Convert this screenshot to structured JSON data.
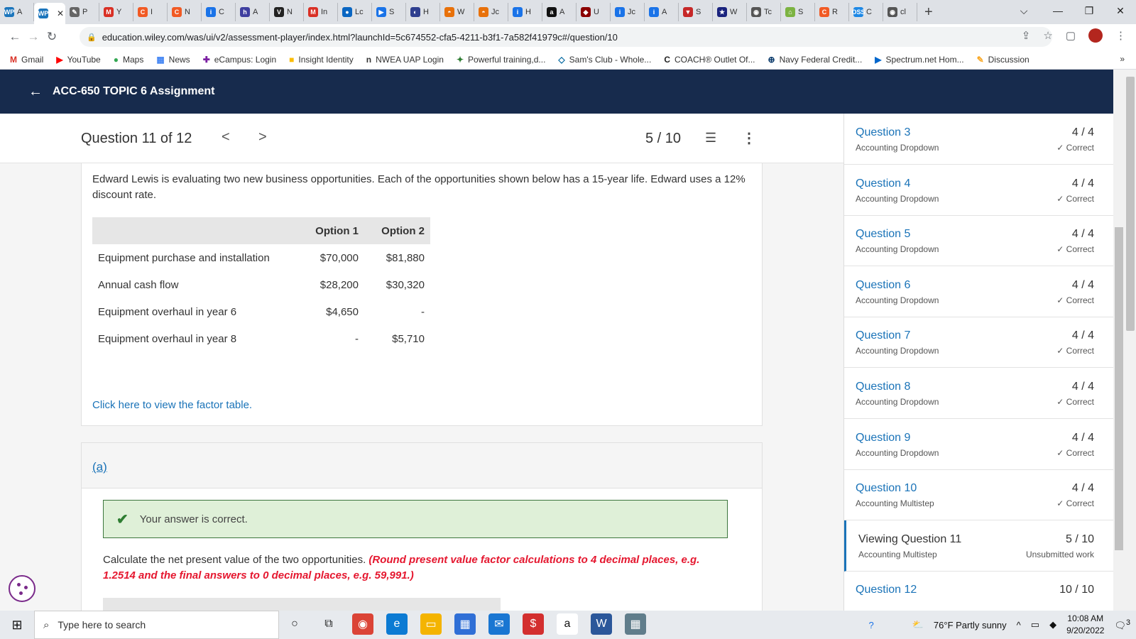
{
  "browser": {
    "tabs": [
      {
        "label": "A",
        "icon": "WP",
        "color": "#1b75bc"
      },
      {
        "label": "",
        "icon": "WP",
        "color": "#1b75bc",
        "active": true
      },
      {
        "label": "P",
        "icon": "✎",
        "color": "#666666"
      },
      {
        "label": "Y",
        "icon": "M",
        "color": "#d93025"
      },
      {
        "label": "I",
        "icon": "C",
        "color": "#f15a24"
      },
      {
        "label": "N",
        "icon": "C",
        "color": "#f15a24"
      },
      {
        "label": "C",
        "icon": "i",
        "color": "#1a73e8"
      },
      {
        "label": "A",
        "icon": "h",
        "color": "#3f3f9f"
      },
      {
        "label": "N",
        "icon": "V",
        "color": "#222222"
      },
      {
        "label": "In",
        "icon": "M",
        "color": "#d93025"
      },
      {
        "label": "Lc",
        "icon": "●",
        "color": "#0a66c2"
      },
      {
        "label": "S",
        "icon": "▶",
        "color": "#1a73e8"
      },
      {
        "label": "H",
        "icon": "◐",
        "color": "#2f3f8f"
      },
      {
        "label": "W",
        "icon": "◓",
        "color": "#e8710a"
      },
      {
        "label": "Jc",
        "icon": "◓",
        "color": "#e8710a"
      },
      {
        "label": "H",
        "icon": "i",
        "color": "#1a73e8"
      },
      {
        "label": "A",
        "icon": "a",
        "color": "#111111"
      },
      {
        "label": "U",
        "icon": "◆",
        "color": "#8b0000"
      },
      {
        "label": "Jc",
        "icon": "i",
        "color": "#1a73e8"
      },
      {
        "label": "A",
        "icon": "i",
        "color": "#1a73e8"
      },
      {
        "label": "S",
        "icon": "▼",
        "color": "#c62828"
      },
      {
        "label": "W",
        "icon": "★",
        "color": "#1a237e"
      },
      {
        "label": "Tc",
        "icon": "◉",
        "color": "#555555"
      },
      {
        "label": "S",
        "icon": "⌂",
        "color": "#7cb342"
      },
      {
        "label": "R",
        "icon": "C",
        "color": "#f15a24"
      },
      {
        "label": "C",
        "icon": "OSS",
        "color": "#1e88e5"
      },
      {
        "label": "cl",
        "icon": "◉",
        "color": "#555555"
      }
    ],
    "new_tab": "+",
    "window": {
      "chevron": "⌵",
      "minimize": "—",
      "restore": "❐",
      "close": "✕"
    },
    "url": "education.wiley.com/was/ui/v2/assessment-player/index.html?launchId=5c674552-cfa5-4211-b3f1-7a582f41979c#/question/10",
    "bookmarks": [
      {
        "label": "Gmail",
        "icon": "M",
        "color": "#d93025"
      },
      {
        "label": "YouTube",
        "icon": "▶",
        "color": "#ff0000"
      },
      {
        "label": "Maps",
        "icon": "●",
        "color": "#34a853"
      },
      {
        "label": "News",
        "icon": "▦",
        "color": "#4285f4"
      },
      {
        "label": "eCampus: Login",
        "icon": "✚",
        "color": "#7b1fa2"
      },
      {
        "label": "Insight Identity",
        "icon": "■",
        "color": "#fbbc05"
      },
      {
        "label": "NWEA UAP Login",
        "icon": "n",
        "color": "#333333"
      },
      {
        "label": "Powerful training,d...",
        "icon": "✦",
        "color": "#2e7d32"
      },
      {
        "label": "Sam's Club - Whole...",
        "icon": "◇",
        "color": "#0067a0"
      },
      {
        "label": "COACH® Outlet Of...",
        "icon": "C",
        "color": "#222222"
      },
      {
        "label": "Navy Federal Credit...",
        "icon": "⊕",
        "color": "#003366"
      },
      {
        "label": "Spectrum.net Hom...",
        "icon": "▶",
        "color": "#0066cc"
      },
      {
        "label": "Discussion",
        "icon": "✎",
        "color": "#f9a825"
      }
    ],
    "bookmarks_more": "»"
  },
  "header": {
    "title": "ACC-650 TOPIC 6 Assignment"
  },
  "question_bar": {
    "title": "Question 11 of 12",
    "prev": "<",
    "next": ">",
    "score": "5 / 10",
    "list_icon": "☰",
    "more_icon": "⋮"
  },
  "question": {
    "text": "Edward Lewis is evaluating two new business opportunities. Each of the opportunities shown below has a 15-year life. Edward uses a 12% discount rate.",
    "table": {
      "headers": [
        "",
        "Option 1",
        "Option 2"
      ],
      "rows": [
        [
          "Equipment purchase and installation",
          "$70,000",
          "$81,880"
        ],
        [
          "Annual cash flow",
          "$28,200",
          "$30,320"
        ],
        [
          "Equipment overhaul in year 6",
          "$4,650",
          "-"
        ],
        [
          "Equipment overhaul in year 8",
          "-",
          "$5,710"
        ]
      ]
    },
    "factor_link": "Click here to view the factor table."
  },
  "part_a": {
    "label": "(a)",
    "correct_msg": "Your answer is correct.",
    "instruction": "Calculate the net present value of the two opportunities.",
    "instruction_red": "(Round present value factor calculations to 4 decimal places, e.g. 1.2514 and the final answers to 0 decimal places, e.g. 59,991.)"
  },
  "sidebar": {
    "items": [
      {
        "title": "Question 3",
        "sub": "Accounting Dropdown",
        "score": "4 / 4",
        "status": "✓ Correct"
      },
      {
        "title": "Question 4",
        "sub": "Accounting Dropdown",
        "score": "4 / 4",
        "status": "✓ Correct"
      },
      {
        "title": "Question 5",
        "sub": "Accounting Dropdown",
        "score": "4 / 4",
        "status": "✓ Correct"
      },
      {
        "title": "Question 6",
        "sub": "Accounting Dropdown",
        "score": "4 / 4",
        "status": "✓ Correct"
      },
      {
        "title": "Question 7",
        "sub": "Accounting Dropdown",
        "score": "4 / 4",
        "status": "✓ Correct"
      },
      {
        "title": "Question 8",
        "sub": "Accounting Dropdown",
        "score": "4 / 4",
        "status": "✓ Correct"
      },
      {
        "title": "Question 9",
        "sub": "Accounting Dropdown",
        "score": "4 / 4",
        "status": "✓ Correct"
      },
      {
        "title": "Question 10",
        "sub": "Accounting Multistep",
        "score": "4 / 4",
        "status": "✓ Correct"
      },
      {
        "title": "Viewing Question 11",
        "sub": "Accounting Multistep",
        "score": "5 / 10",
        "status": "Unsubmitted work",
        "current": true
      },
      {
        "title": "Question 12",
        "sub": "",
        "score": "10 / 10",
        "status": ""
      }
    ]
  },
  "taskbar": {
    "search_placeholder": "Type here to search",
    "weather": "76°F  Partly sunny",
    "time": "10:08 AM",
    "date": "9/20/2022",
    "notifications": "3"
  },
  "colors": {
    "header_bg": "#172b4d",
    "link": "#1a73b8",
    "success_bg": "#dff0d8",
    "success_border": "#3c763d",
    "instruction_red": "#e5172f"
  }
}
